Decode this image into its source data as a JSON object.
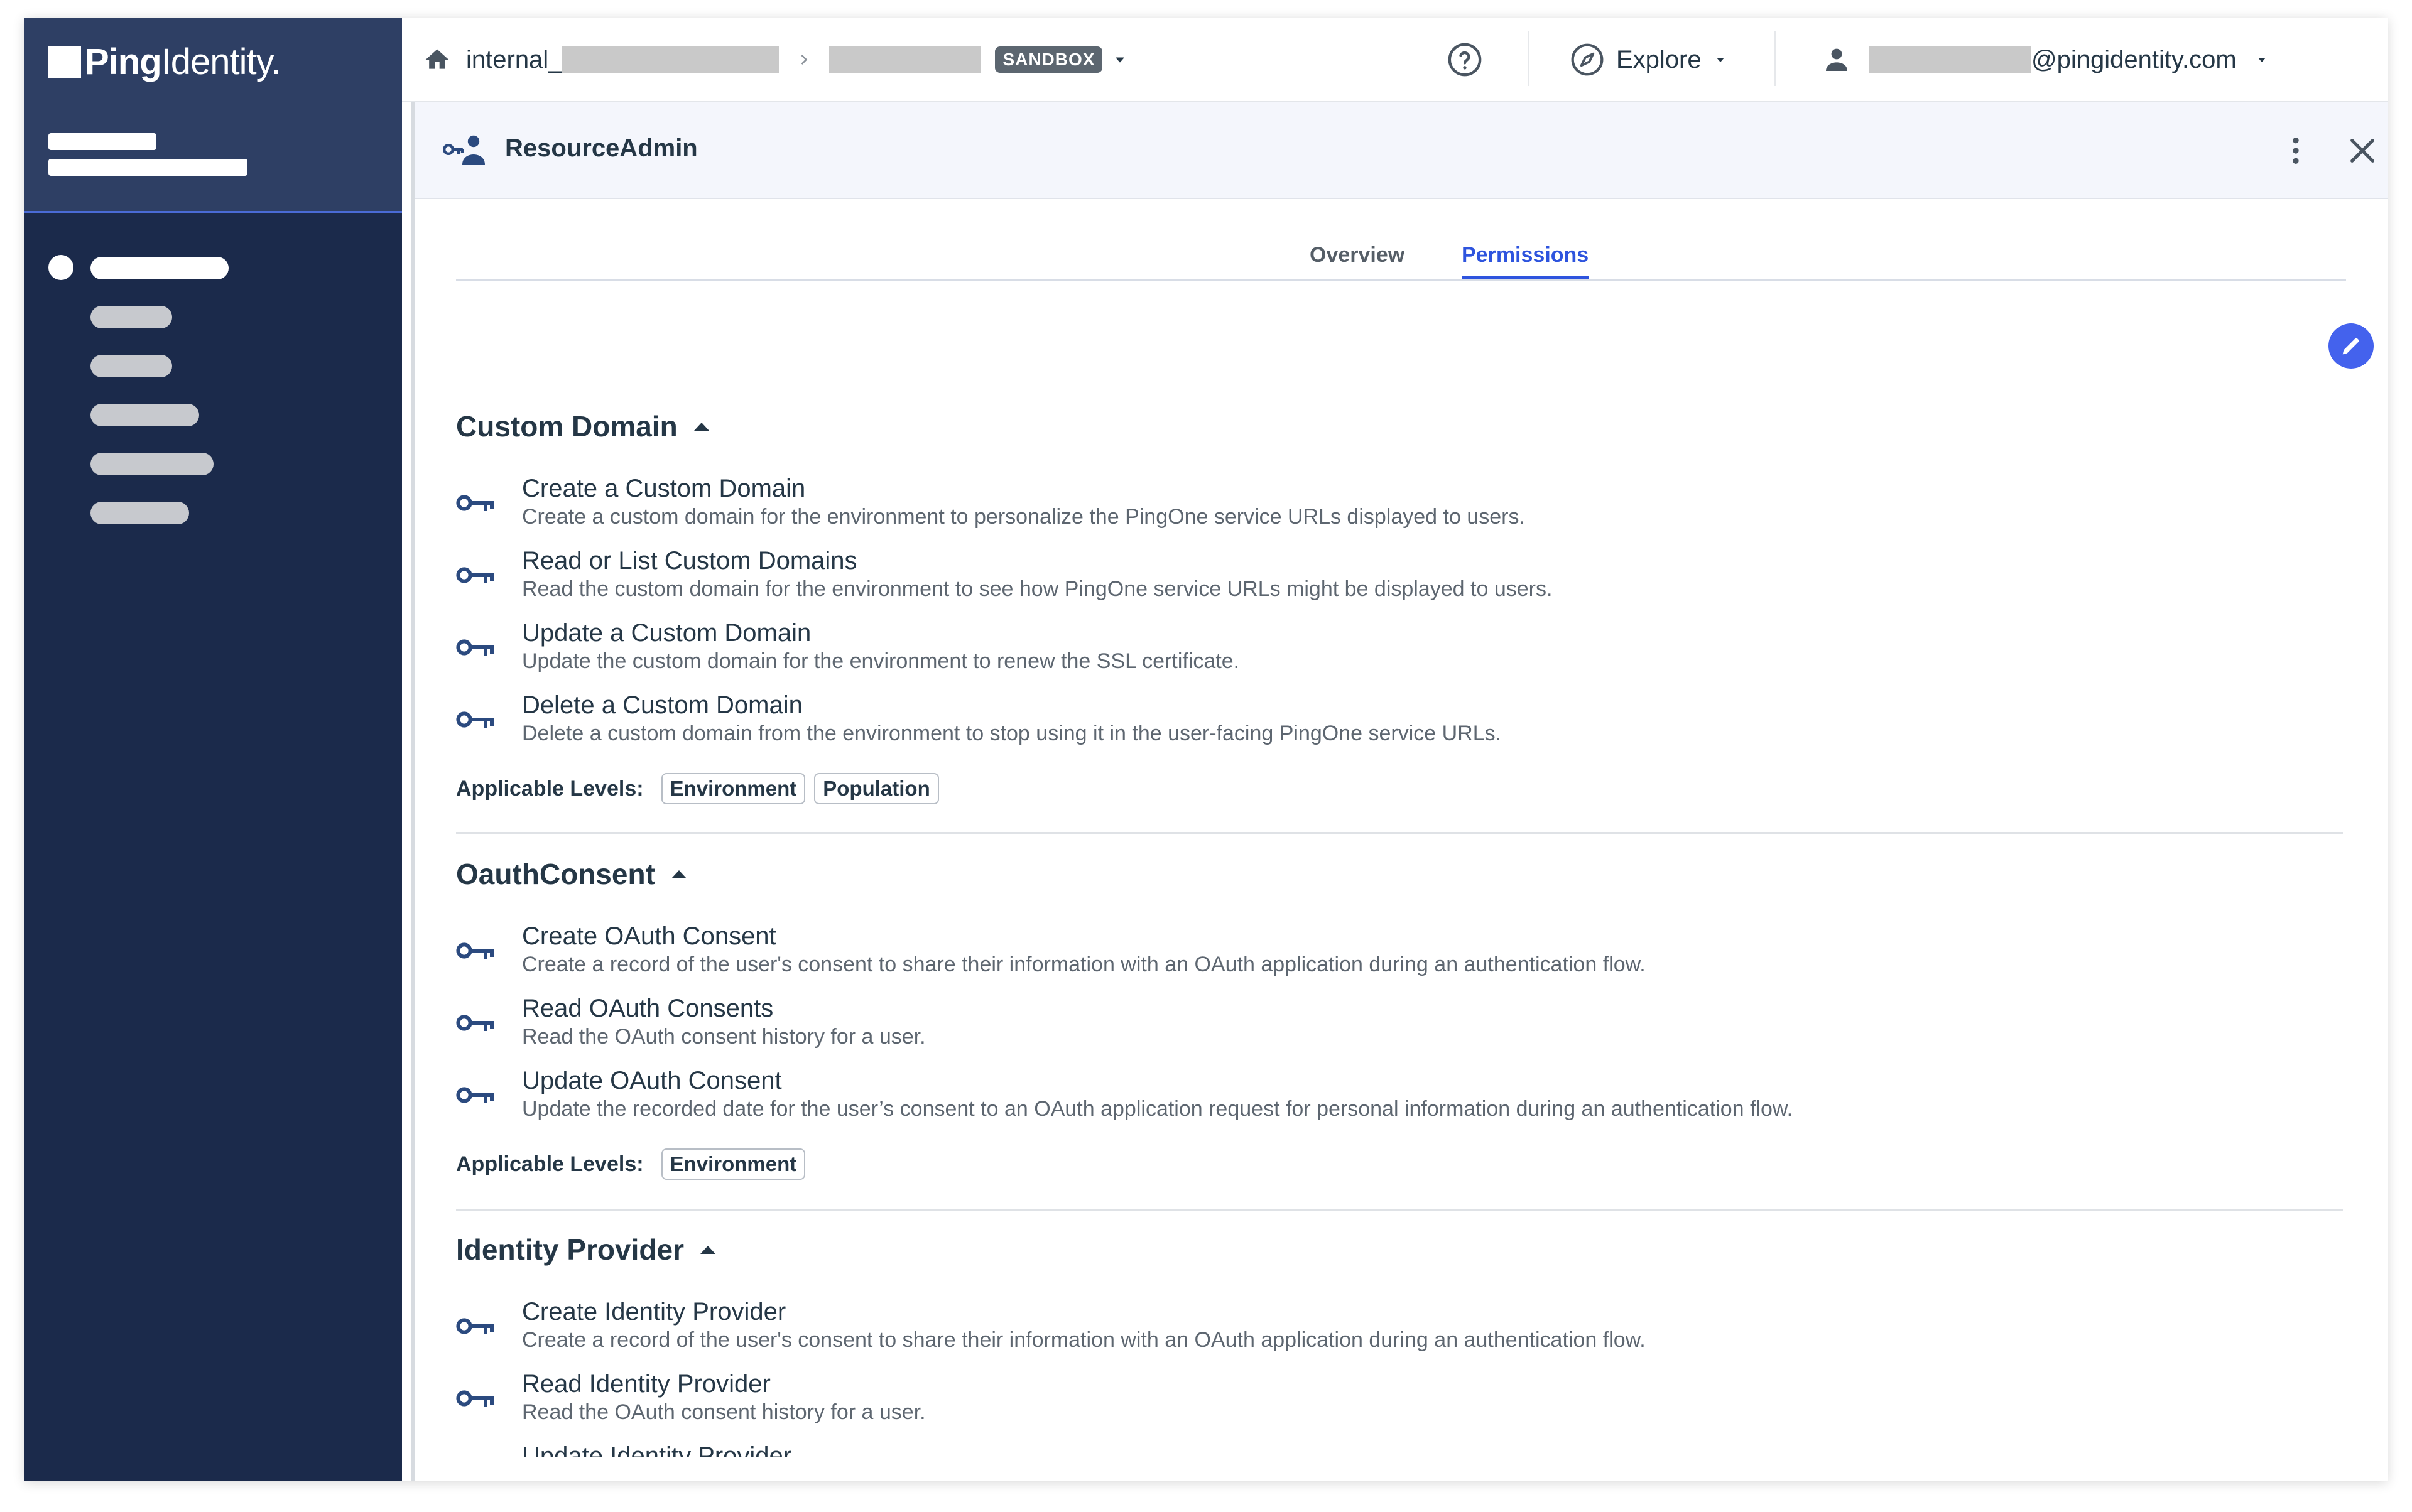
{
  "brand": {
    "logo_bold": "Ping",
    "logo_light": "Identity",
    "logo_mark": "."
  },
  "header": {
    "breadcrumb_env_prefix": "internal_",
    "env_badge": "SANDBOX",
    "explore_label": "Explore",
    "user_email_suffix": "@pingidentity.com"
  },
  "panel": {
    "title": "ResourceAdmin",
    "tabs": [
      {
        "label": "Overview",
        "active": false
      },
      {
        "label": "Permissions",
        "active": true
      }
    ]
  },
  "sections": [
    {
      "title": "Custom Domain",
      "expanded": true,
      "permissions": [
        {
          "name": "Create a Custom Domain",
          "description": "Create a custom domain for the environment to personalize the PingOne service URLs displayed to users."
        },
        {
          "name": "Read or List Custom Domains",
          "description": "Read the custom domain for the environment to see how PingOne service URLs might be displayed to users."
        },
        {
          "name": "Update a Custom Domain",
          "description": "Update the custom domain for the environment to renew the SSL certificate."
        },
        {
          "name": "Delete a Custom Domain",
          "description": "Delete a custom domain from the environment to stop using it in the user-facing PingOne service URLs."
        }
      ],
      "levels_label": "Applicable Levels:",
      "levels": [
        "Environment",
        "Population"
      ]
    },
    {
      "title": "OauthConsent",
      "expanded": true,
      "permissions": [
        {
          "name": "Create OAuth Consent",
          "description": "Create a record of the user's consent to share their information with an OAuth application during an authentication flow."
        },
        {
          "name": "Read OAuth Consents",
          "description": "Read the OAuth consent history for a user."
        },
        {
          "name": "Update OAuth Consent",
          "description": "Update the recorded date for the user’s consent to an OAuth application request for personal information during an authentication flow."
        }
      ],
      "levels_label": "Applicable Levels:",
      "levels": [
        "Environment"
      ]
    },
    {
      "title": "Identity Provider",
      "expanded": true,
      "permissions": [
        {
          "name": "Create Identity Provider",
          "description": "Create a record of the user's consent to share their information with an OAuth application during an authentication flow."
        },
        {
          "name": "Read Identity Provider",
          "description": "Read the OAuth consent history for a user."
        },
        {
          "name": "Update Identity Provider",
          "description": ""
        }
      ]
    }
  ],
  "colors": {
    "sidebar": "#1b2a4b",
    "sidebar_header": "#2e3f64",
    "accent": "#2e54de",
    "key_icon": "#2b4a7f",
    "edit_button": "#4462ed"
  },
  "icons": [
    "home-icon",
    "chevron-right-icon",
    "chevron-down-icon",
    "help-icon",
    "compass-icon",
    "user-icon",
    "key-user-icon",
    "more-vertical-icon",
    "close-icon",
    "pencil-icon",
    "key-icon",
    "caret-up-icon"
  ]
}
